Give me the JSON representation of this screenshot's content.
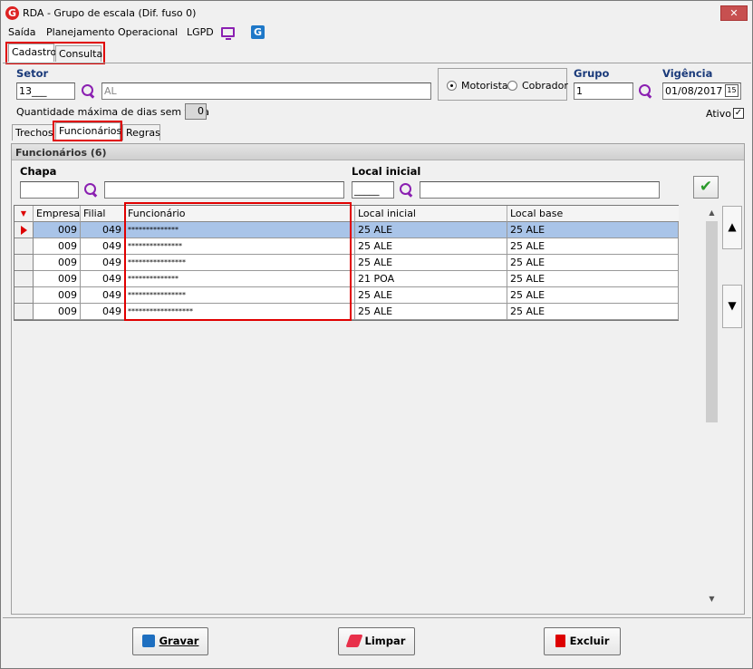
{
  "window": {
    "title": "RDA - Grupo de escala (Dif. fuso 0)",
    "app_icon": "G",
    "close": "✕"
  },
  "menu": {
    "items": [
      "Saída",
      "Planejamento Operacional",
      "LGPD"
    ],
    "tv_icon": "monitor-icon",
    "g_icon": "G"
  },
  "top_tabs": [
    "Cadastro",
    "Consulta"
  ],
  "setor": {
    "label": "Setor",
    "code": "13___",
    "name": "AL"
  },
  "role": {
    "options": [
      "Motorista",
      "Cobrador"
    ],
    "selected": "Motorista"
  },
  "grupo": {
    "label": "Grupo",
    "value": "1"
  },
  "vigencia": {
    "label": "Vigência",
    "value": "01/08/2017",
    "cal_label": "15"
  },
  "max_days": {
    "label": "Quantidade máxima de dias sem folga",
    "value": "0"
  },
  "ativo": {
    "label": "Ativo",
    "checked": "✓"
  },
  "sub_tabs": [
    "Trechos",
    "Funcionários",
    "Regras"
  ],
  "panel": {
    "header": "Funcionários (6)",
    "chapa_label": "Chapa",
    "local_label": "Local inicial",
    "local_value": "_____"
  },
  "grid": {
    "columns": [
      "Empresa",
      "Filial",
      "Funcionário",
      "Local inicial",
      "Local base"
    ],
    "rows": [
      [
        "009",
        "049",
        "**************",
        "25 ALE",
        "25 ALE"
      ],
      [
        "009",
        "049",
        "***************",
        "25 ALE",
        "25 ALE"
      ],
      [
        "009",
        "049",
        "****************",
        "25 ALE",
        "25 ALE"
      ],
      [
        "009",
        "049",
        "**************",
        "21 POA",
        "25 ALE"
      ],
      [
        "009",
        "049",
        "****************",
        "25 ALE",
        "25 ALE"
      ],
      [
        "009",
        "049",
        "******************",
        "25 ALE",
        "25 ALE"
      ]
    ]
  },
  "buttons": {
    "save": "Gravar",
    "clear": "Limpar",
    "delete": "Excluir"
  },
  "colors": {
    "highlight": "#e00000",
    "selected_row": "#a9c4e8",
    "accent_purple": "#8a1fb1"
  }
}
